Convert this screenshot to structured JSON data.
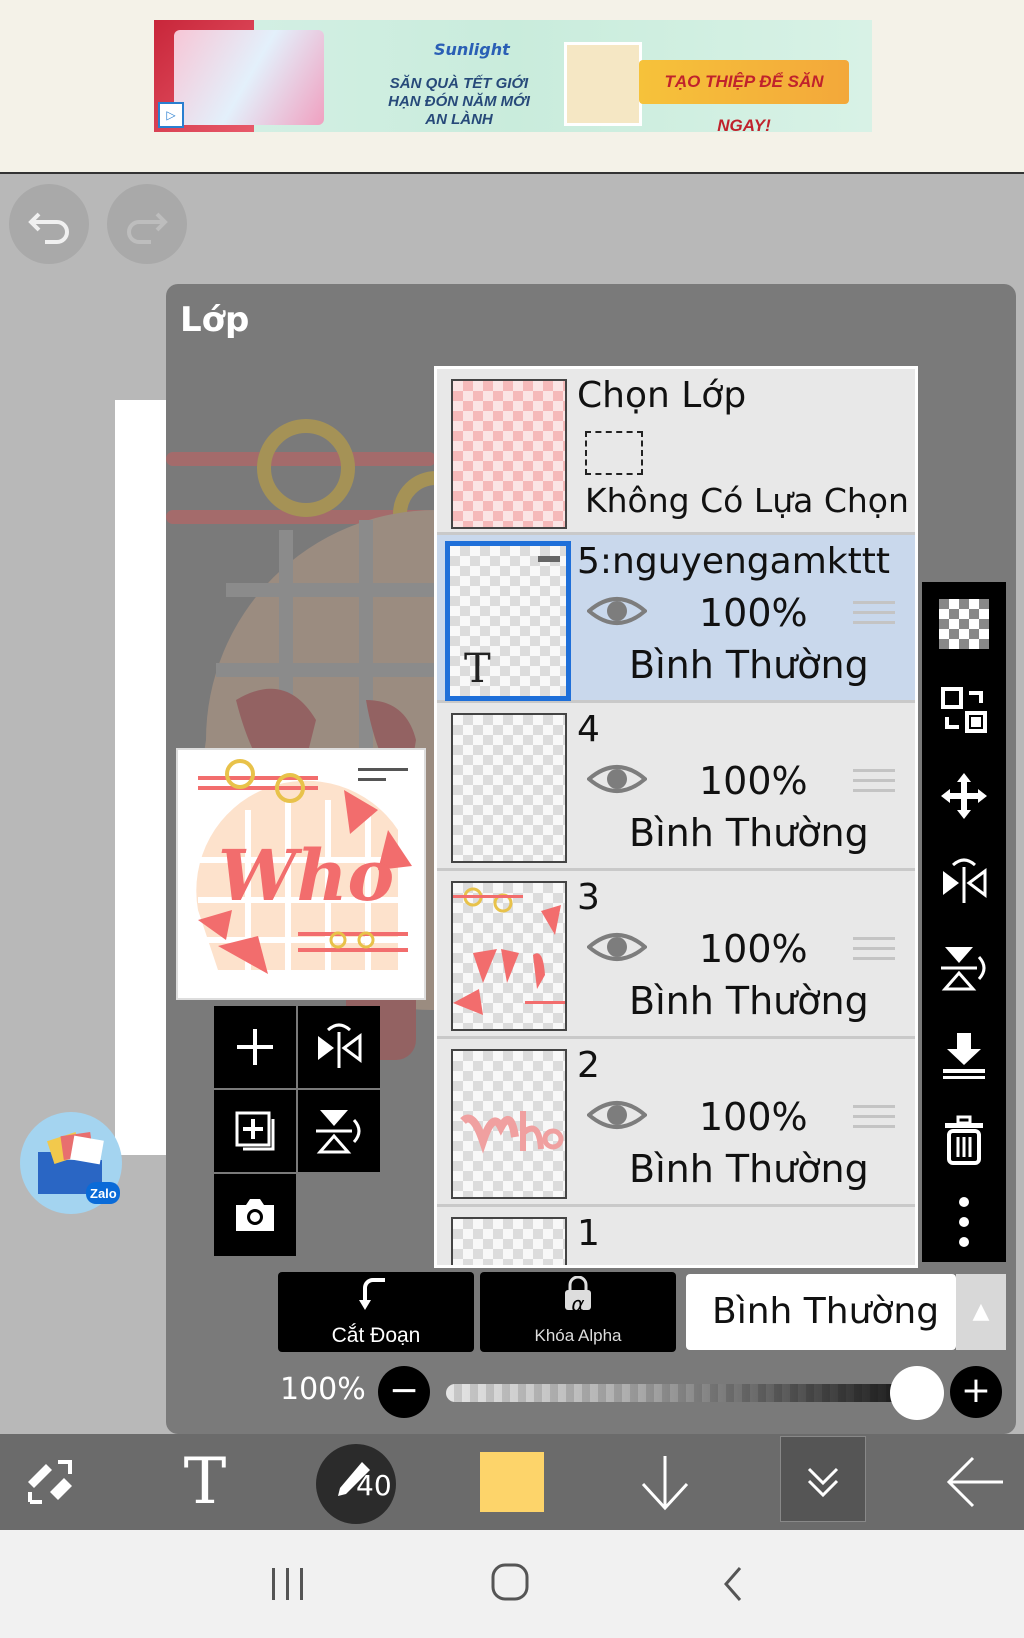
{
  "ad": {
    "brand": "Sunlight",
    "tagline": "SĂN QUÀ TẾT GIỚI HẠN ĐÓN NĂM MỚI AN LÀNH",
    "cta": "TẠO THIỆP ĐỂ SĂN NGAY!",
    "play_icon": "▷"
  },
  "history": {
    "undo_icon": "undo-icon",
    "redo_icon": "redo-icon"
  },
  "panel": {
    "title": "Lớp"
  },
  "selection_layer": {
    "title": "Chọn Lớp",
    "status": "Không Có Lựa Chọn"
  },
  "layers": [
    {
      "name": "5:nguyengamkttt",
      "opacity": "100%",
      "blend": "Bình Thường",
      "type": "text",
      "thumb_letter": "T",
      "selected": true
    },
    {
      "name": "4",
      "opacity": "100%",
      "blend": "Bình Thường",
      "selected": false
    },
    {
      "name": "3",
      "opacity": "100%",
      "blend": "Bình Thường",
      "selected": false
    },
    {
      "name": "2",
      "opacity": "100%",
      "blend": "Bình Thường",
      "selected": false
    },
    {
      "name": "1",
      "selected": false
    }
  ],
  "actions": {
    "clip_label": "Cắt Đoạn",
    "alpha_lock_label": "Khóa Alpha",
    "alpha_symbol": "α",
    "blend_mode": "Bình Thường"
  },
  "opacity": {
    "label": "100%",
    "value": 100
  },
  "bottom": {
    "brush_size": "40",
    "color": "#fdd46a",
    "text_tool_glyph": "T"
  },
  "preview": {
    "word": "Who"
  },
  "colors": {
    "accent": "#1e6fd9",
    "art_red": "#f26d6d",
    "art_gold": "#e8c24a",
    "panel": "#7a7a7a"
  }
}
